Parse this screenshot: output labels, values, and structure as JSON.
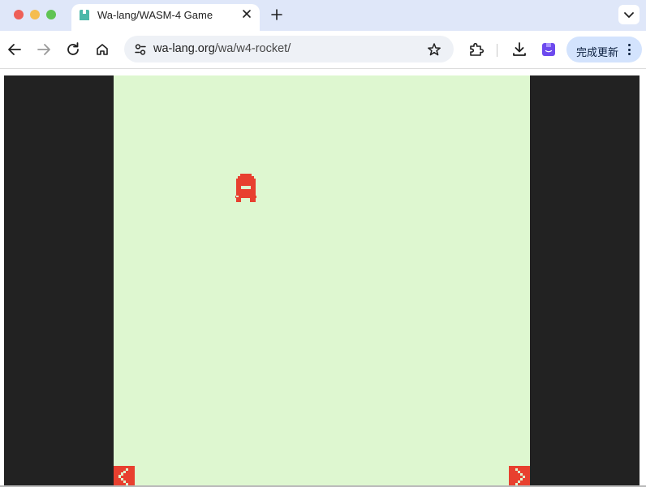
{
  "browser": {
    "tab": {
      "title": "Wa-lang/WASM-4 Game",
      "close_icon": "close-icon",
      "favicon": "wa-favicon-icon"
    },
    "new_tab_icon": "plus-icon",
    "tab_search_icon": "chevron-down-icon",
    "nav": {
      "back_icon": "arrow-left-icon",
      "forward_icon": "arrow-right-icon",
      "reload_icon": "reload-icon",
      "home_icon": "home-icon"
    },
    "omnibox": {
      "url_host": "wa-lang.org",
      "url_path": "/wa/w4-rocket/",
      "site_info_icon": "tune-icon",
      "bookmark_icon": "star-icon"
    },
    "extensions_icon": "puzzle-icon",
    "downloads_icon": "download-icon",
    "profile_icon": "bookmark-profile-icon",
    "update_button": {
      "label": "完成更新",
      "menu_icon": "kebab-menu-icon"
    }
  },
  "game": {
    "name": "w4-rocket",
    "colors": {
      "screen": "#def7d0",
      "frame": "#222222",
      "sprite": "#e8402f"
    },
    "controls": {
      "left_icon": "left-arrow-control-icon",
      "right_icon": "right-arrow-control-icon"
    }
  }
}
